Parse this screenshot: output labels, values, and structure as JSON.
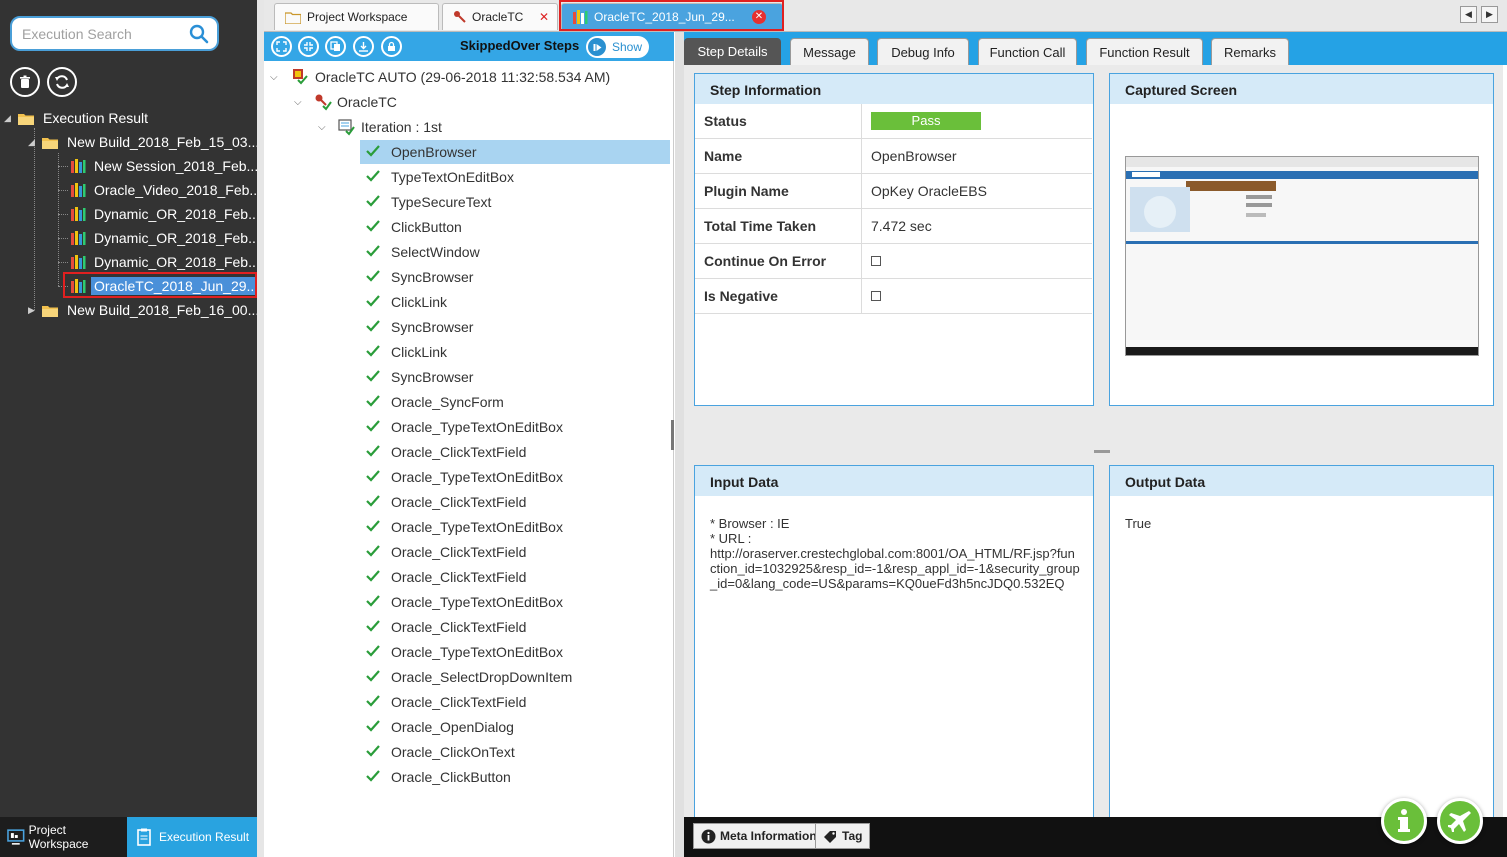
{
  "search": {
    "placeholder": "Execution Search"
  },
  "left_tree": {
    "root": "Execution Result",
    "build1": "New Build_2018_Feb_15_03...",
    "children": [
      "New Session_2018_Feb...",
      "Oracle_Video_2018_Feb...",
      "Dynamic_OR_2018_Feb...",
      "Dynamic_OR_2018_Feb...",
      "Dynamic_OR_2018_Feb...",
      "OracleTC_2018_Jun_29..."
    ],
    "build2": "New Build_2018_Feb_16_00..."
  },
  "bottom_nav": {
    "project_workspace": "Project Workspace",
    "execution_result": "Execution Result"
  },
  "doc_tabs": {
    "project_workspace": "Project Workspace",
    "oracle_tc": "OracleTC",
    "oracle_tc_run": "OracleTC_2018_Jun_29..."
  },
  "steps_panel": {
    "toolbar_title": "SkippedOver Steps",
    "show_label": "Show",
    "run_title": "OracleTC AUTO (29-06-2018 11:32:58.534 AM)",
    "testcase": "OracleTC",
    "iteration": "Iteration : 1st",
    "steps": [
      "OpenBrowser",
      "TypeTextOnEditBox",
      "TypeSecureText",
      "ClickButton",
      "SelectWindow",
      "SyncBrowser",
      "ClickLink",
      "SyncBrowser",
      "ClickLink",
      "SyncBrowser",
      "Oracle_SyncForm",
      "Oracle_TypeTextOnEditBox",
      "Oracle_ClickTextField",
      "Oracle_TypeTextOnEditBox",
      "Oracle_ClickTextField",
      "Oracle_TypeTextOnEditBox",
      "Oracle_ClickTextField",
      "Oracle_ClickTextField",
      "Oracle_TypeTextOnEditBox",
      "Oracle_ClickTextField",
      "Oracle_TypeTextOnEditBox",
      "Oracle_SelectDropDownItem",
      "Oracle_ClickTextField",
      "Oracle_OpenDialog",
      "Oracle_ClickOnText",
      "Oracle_ClickButton"
    ]
  },
  "detail_tabs": [
    "Step Details",
    "Message",
    "Debug Info",
    "Function Call",
    "Function Result",
    "Remarks"
  ],
  "step_info": {
    "title": "Step Information",
    "rows": [
      {
        "key": "Status",
        "value": "Pass"
      },
      {
        "key": "Name",
        "value": "OpenBrowser"
      },
      {
        "key": "Plugin Name",
        "value": "OpKey OracleEBS"
      },
      {
        "key": "Total Time Taken",
        "value": "7.472 sec"
      },
      {
        "key": "Continue On Error",
        "value": ""
      },
      {
        "key": "Is Negative",
        "value": ""
      }
    ]
  },
  "captured_screen": {
    "title": "Captured Screen"
  },
  "input_data": {
    "title": "Input Data",
    "lines": [
      "* Browser : IE",
      "* URL :",
      "http://oraserver.crestechglobal.com:8001/OA_HTML/RF.jsp?function_id=1032925&resp_id=-1&resp_appl_id=-1&security_group_id=0&lang_code=US&params=KQ0ueFd3h5ncJDQ0.532EQ"
    ]
  },
  "output_data": {
    "title": "Output Data",
    "value": "True"
  },
  "footer": {
    "meta_information": "Meta Information",
    "tag": "Tag"
  },
  "colors": {
    "accent": "#29a3e0",
    "pass": "#6abf3a",
    "sidebar": "#333333",
    "selection_border": "#e02020"
  }
}
